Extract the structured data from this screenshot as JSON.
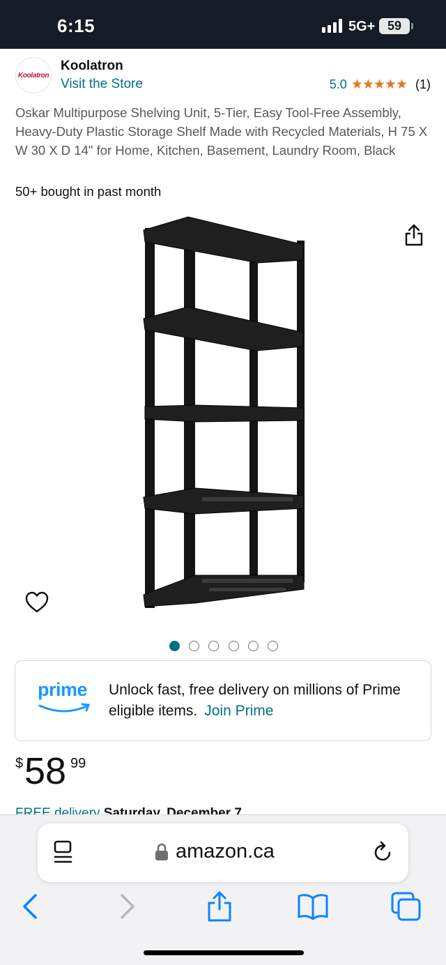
{
  "status_bar": {
    "time": "6:15",
    "network": "5G+",
    "battery": "59"
  },
  "brand": {
    "logo_text": "Koolatron",
    "name": "Koolatron",
    "visit_store": "Visit the Store",
    "rating_score": "5.0",
    "rating_stars": "★★★★★",
    "rating_count": "(1)"
  },
  "product": {
    "title": "Oskar Multipurpose Shelving Unit, 5-Tier, Easy Tool-Free Assembly, Heavy-Duty Plastic Storage Shelf Made with Recycled Materials, H 75 X W 30 X D 14\" for Home, Kitchen, Basement, Laundry Room, Black",
    "bought": "50+ bought in past month",
    "image_count": 6,
    "active_image": 1
  },
  "prime": {
    "logo_word": "prime",
    "message": "Unlock fast, free delivery on millions of Prime eligible items.",
    "join_label": "Join Prime"
  },
  "price": {
    "symbol": "$",
    "whole": "58",
    "fraction": "99"
  },
  "delivery": {
    "label": "FREE delivery",
    "date": "Saturday, December 7"
  },
  "browser": {
    "host": "amazon.ca"
  },
  "colors": {
    "link": "#007185",
    "star": "#de7921",
    "prime_blue": "#1a98ff",
    "ios_blue": "#0a84ff",
    "status_bar_bg": "#141c27"
  }
}
